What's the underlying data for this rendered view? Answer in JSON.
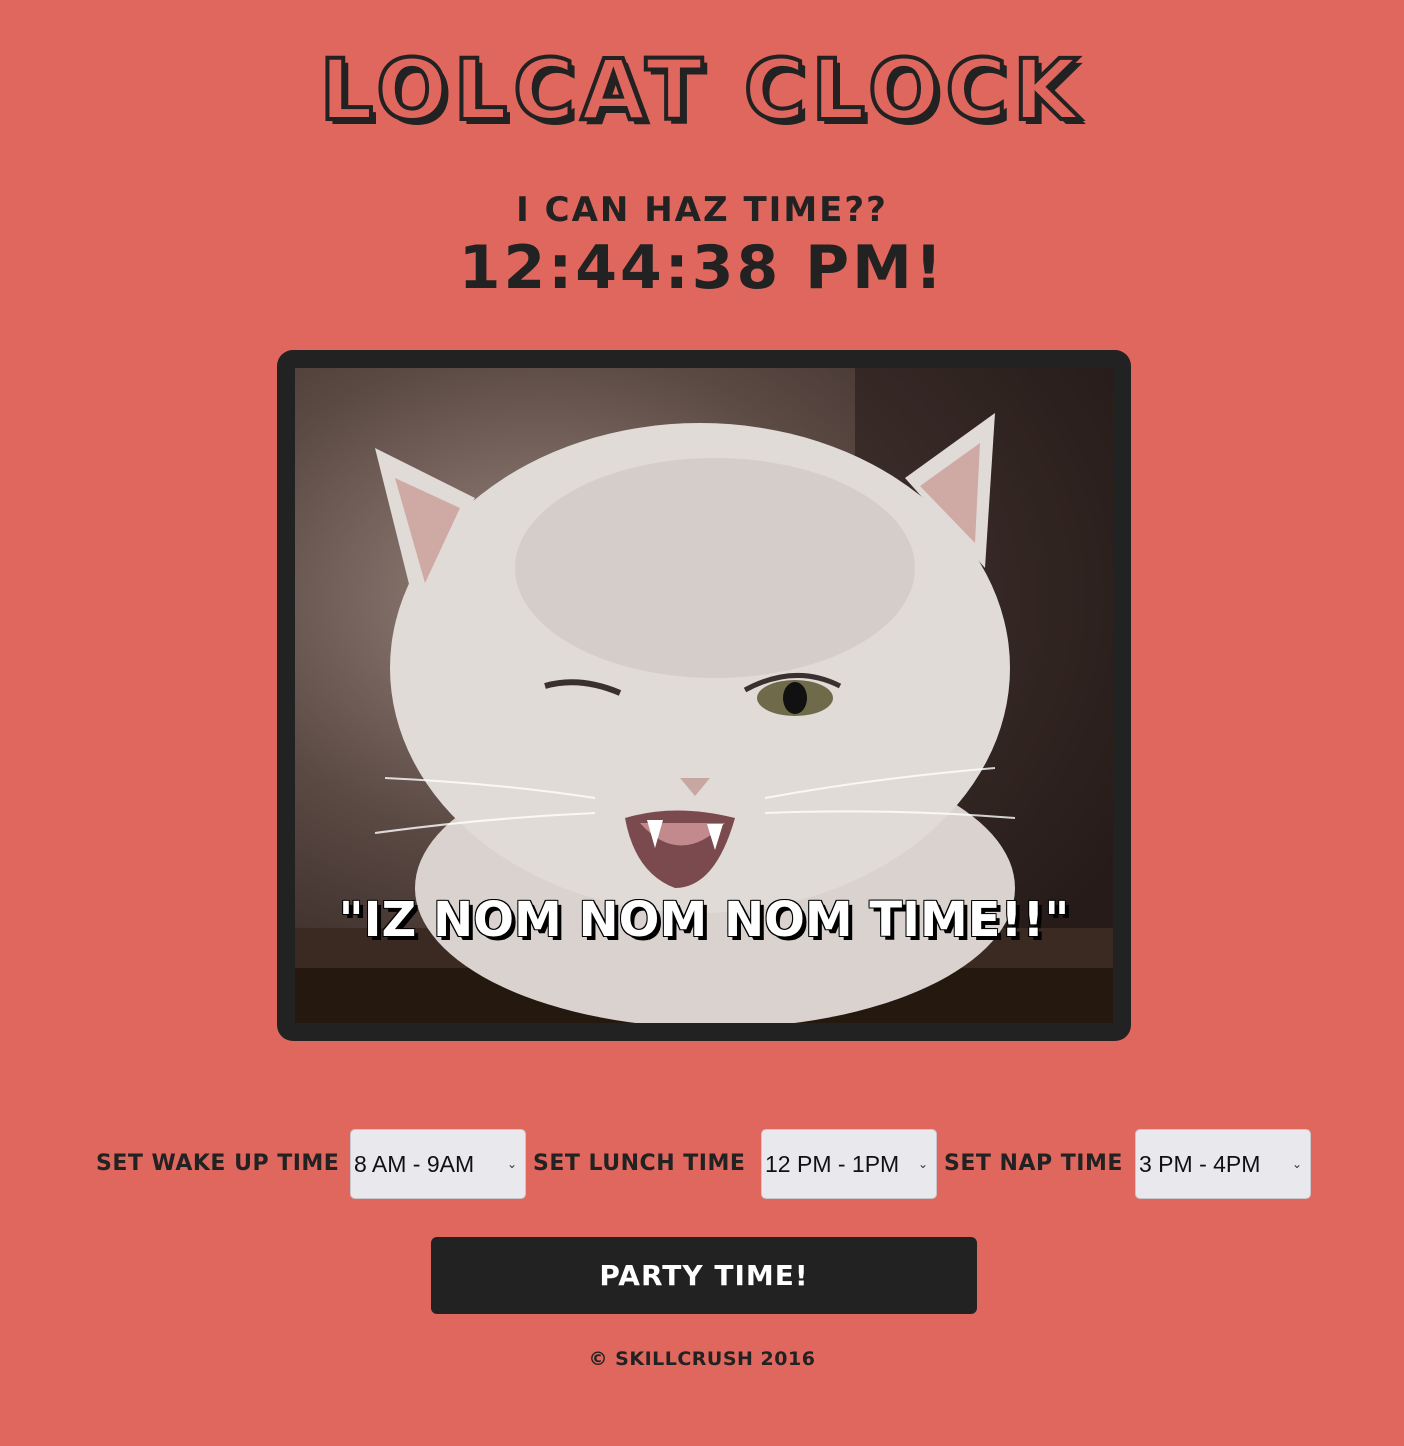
{
  "header": {
    "title": "LOLCAT CLOCK",
    "subtitle": "I CAN HAZ TIME??",
    "clock": "12:44:38 PM!"
  },
  "image": {
    "caption": "\"IZ NOM NOM NOM TIME!!\""
  },
  "controls": {
    "wake": {
      "label": "SET WAKE UP TIME",
      "value": "8 AM - 9AM"
    },
    "lunch": {
      "label": "SET LUNCH TIME",
      "value": "12 PM - 1PM"
    },
    "nap": {
      "label": "SET NAP TIME",
      "value": "3 PM - 4PM"
    }
  },
  "button": {
    "label": "PARTY TIME!"
  },
  "footer": {
    "text": "© SKILLCRUSH 2016"
  },
  "colors": {
    "background": "#e0675e",
    "dark": "#222222",
    "select_bg": "#e9e8ec"
  }
}
